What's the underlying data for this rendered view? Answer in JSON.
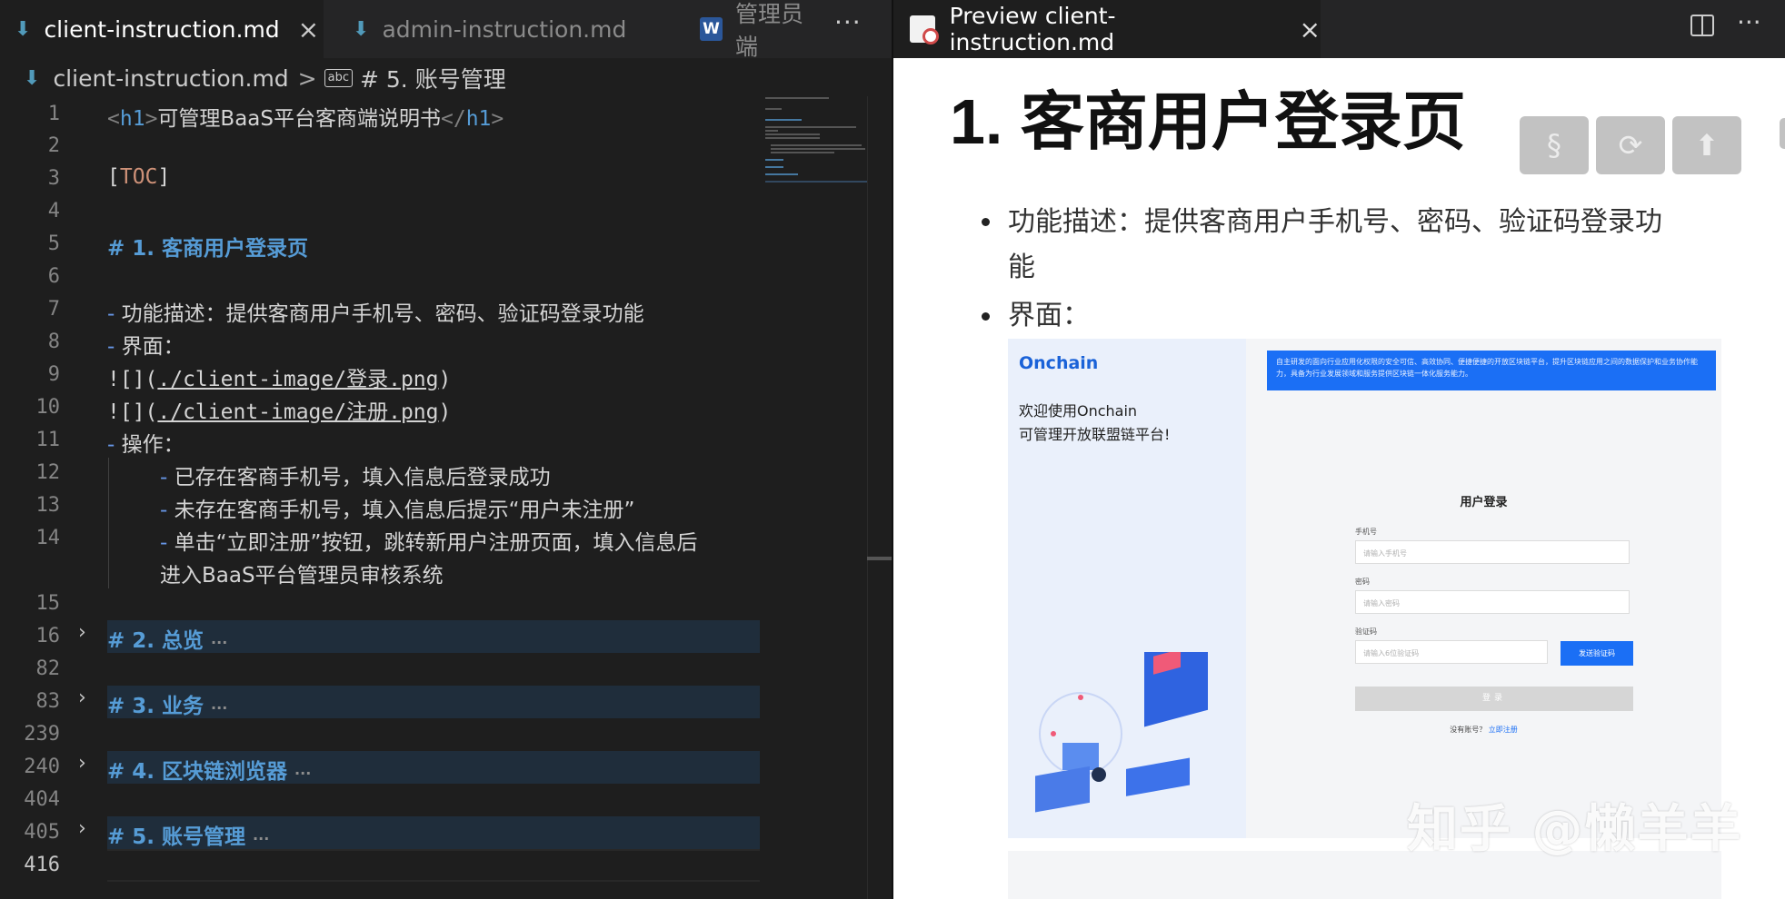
{
  "editor": {
    "tabs": [
      {
        "label": "client-instruction.md",
        "close": "×"
      },
      {
        "label": "admin-instruction.md"
      },
      {
        "label": "管理员端"
      }
    ],
    "more": "···",
    "breadcrumb": {
      "file": "client-instruction.md",
      "sep": ">",
      "abc": "abc",
      "symbol": "# 5. 账号管理"
    },
    "line_numbers": [
      "1",
      "2",
      "3",
      "4",
      "5",
      "6",
      "7",
      "8",
      "9",
      "10",
      "11",
      "12",
      "13",
      "14",
      "15",
      "16",
      "82",
      "83",
      "239",
      "240",
      "404",
      "405",
      "416"
    ],
    "lines": {
      "l1_open": "<",
      "l1_tag": "h1",
      "l1_close_open": ">",
      "l1_text": "可管理BaaS平台客商端说明书",
      "l1_end": "</",
      "l1_end_tag": "h1",
      "l1_end_close": ">",
      "l3_lb": "[",
      "l3_toc": "TOC",
      "l3_rb": "]",
      "l5": "# 1. 客商用户登录页",
      "l7_dash": "-",
      "l7_text": " 功能描述：提供客商用户手机号、密码、验证码登录功能",
      "l8_dash": "-",
      "l8_text": " 界面：",
      "l9_pre": "![](",
      "l9_link": "./client-image/登录.png",
      "l9_post": ")",
      "l10_pre": "![](",
      "l10_link": "./client-image/注册.png",
      "l10_post": ")",
      "l11_dash": "-",
      "l11_text": " 操作：",
      "l12_dash": "-",
      "l12_text": " 已存在客商手机号，填入信息后登录成功",
      "l13_dash": "-",
      "l13_text": " 未存在客商手机号，填入信息后提示“用户未注册”",
      "l14_dash": "-",
      "l14_text": " 单击“立即注册”按钮，跳转新用户注册页面，填入信息后",
      "l14_wrap": "进入BaaS平台管理员审核系统",
      "f16": "# 2. 总览",
      "f83": "# 3. 业务",
      "f240": "# 4. 区块链浏览器",
      "f405": "# 5. 账号管理",
      "ellipsis": "···"
    },
    "fold_chevron": "›"
  },
  "preview": {
    "tab_label": "Preview client-instruction.md",
    "close": "×",
    "more": "···",
    "h1": "1. 客商用户登录页",
    "buttons": [
      "§",
      "⟳",
      "⬆"
    ],
    "bullets": [
      {
        "line1": "功能描述：提供客商用户手机号、密码、验证码登录功",
        "line2": "能"
      },
      {
        "line1": "界面："
      }
    ],
    "screenshot": {
      "logo": "Onchain",
      "welcome1": "欢迎使用Onchain",
      "welcome2": "可管理开放联盟链平台!",
      "banner": "自主研发的面向行业应用化权限的安全可信、高效协同、便捷便捷的开放区块链平台，提升区块链应用之间的数据保护和业务协作能力，具备为行业发展领域和服务提供区块链一体化服务能力。",
      "title": "用户登录",
      "phone_label": "手机号",
      "phone_placeholder": "请输入手机号",
      "password_label": "密码",
      "password_placeholder": "请输入密码",
      "code_label": "验证码",
      "code_placeholder": "请输入6位验证码",
      "code_button": "发送验证码",
      "login_button": "登录",
      "register_prompt": "没有账号？",
      "register_link": "立即注册"
    },
    "watermark": "知乎 @懒羊羊"
  },
  "colors": {
    "editor_bg": "#1e1e1e",
    "tab_bar": "#252526",
    "keyword_blue": "#569cd6",
    "string_orange": "#ce9178",
    "accent_blue": "#1b6ff5"
  }
}
